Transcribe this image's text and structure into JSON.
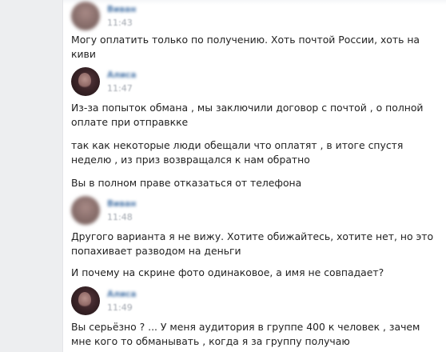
{
  "messages": [
    {
      "author": "Виван",
      "time": "11:43",
      "texts": [
        "Могу оплатить только по получению. Хоть почтой России, хоть на киви"
      ]
    },
    {
      "author": "Алиса",
      "time": "11:47",
      "texts": [
        "Из-за попыток обмана , мы заключили договор с почтой , о полной оплате при отправкке",
        "так как некоторые люди обещали что оплатят , в итоге спустя неделю , из приз возвращался к нам обратно",
        "Вы в полном праве отказаться от телефона"
      ]
    },
    {
      "author": "Виван",
      "time": "11:48",
      "texts": [
        "Другого варианта я не вижу. Хотите обижайтесь, хотите нет, но это попахивает разводом на деньги",
        "И почему на скрине фото одинаковое, а имя не совпадает?"
      ]
    },
    {
      "author": "Алиса",
      "time": "11:49",
      "texts": [
        "Вы серьёзно ? ... У меня аудитория в группе 400 к человек , зачем мне кого то обманывать , когда я за группу получаю"
      ]
    }
  ]
}
